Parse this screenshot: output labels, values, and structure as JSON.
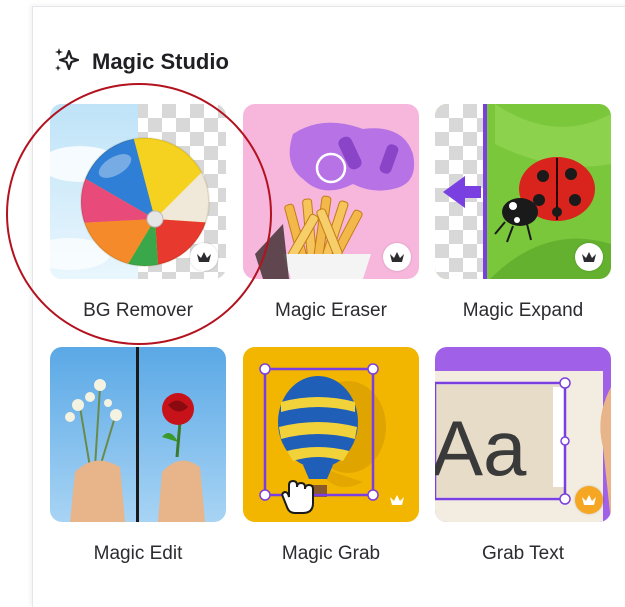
{
  "section": {
    "title": "Magic Studio",
    "icon": "sparkles-icon"
  },
  "tools": [
    {
      "label": "BG Remover",
      "premium": true
    },
    {
      "label": "Magic Eraser",
      "premium": true
    },
    {
      "label": "Magic Expand",
      "premium": true
    },
    {
      "label": "Magic Edit",
      "premium": false
    },
    {
      "label": "Magic Grab",
      "premium": true
    },
    {
      "label": "Grab Text",
      "premium": true
    }
  ],
  "grab_text_preview": "Aa",
  "colors": {
    "highlight": "#b3121f",
    "eraser_bg": "#f7b6dc",
    "expand_bg": "#7bc73b",
    "edit_bg": "#6fb6e8",
    "grab_bg": "#f2b500",
    "grabtext_bg": "#a060e8",
    "premium_gold": "#f5a623"
  }
}
